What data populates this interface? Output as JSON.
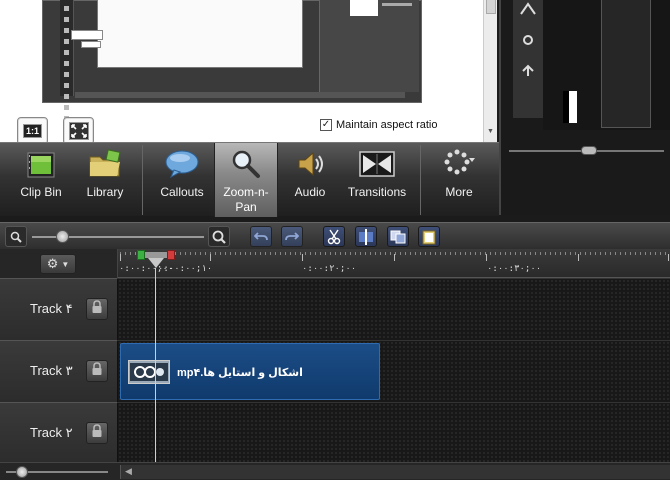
{
  "zoom_panel": {
    "one_to_one_label": "1:1",
    "maintain_aspect_ratio": {
      "label": "Maintain aspect ratio",
      "checked": true,
      "check_glyph": "✓"
    }
  },
  "task_tabs": [
    {
      "label": "Clip Bin",
      "icon": "clip-bin-icon"
    },
    {
      "label": "Library",
      "icon": "library-icon"
    },
    {
      "label": "Callouts",
      "icon": "callouts-icon"
    },
    {
      "label": "Zoom-n-\nPan",
      "icon": "zoom-n-pan-icon",
      "active": true
    },
    {
      "label": "Audio",
      "icon": "audio-icon"
    },
    {
      "label": "Transitions",
      "icon": "transitions-icon"
    },
    {
      "label": "More",
      "icon": "more-icon"
    }
  ],
  "timeline_toolbar": {
    "icons": [
      "zoom-out-icon",
      "zoom-in-icon",
      "undo-icon",
      "redo-icon",
      "cut-icon",
      "split-icon",
      "copy-icon",
      "paste-icon"
    ]
  },
  "ruler": {
    "labels": [
      "۰:۰۰:۰۰;۰۰",
      "۰:۰۰:۰۰;۱۰",
      "۰:۰۰:۲۰;۰۰",
      "۰:۰۰:۳۰;۰۰"
    ]
  },
  "tracks": [
    {
      "name": "Track ۴",
      "locked": false
    },
    {
      "name": "Track ۳",
      "locked": false
    },
    {
      "name": "Track ۲",
      "locked": false
    }
  ],
  "clip": {
    "title": "اشکال و استایل ها.mp۴"
  },
  "colors": {
    "clip_fill": "#1c4d86",
    "playhead_green": "#3cb043",
    "playhead_red": "#d23c3c",
    "active_tab": "#8a8a8a"
  }
}
